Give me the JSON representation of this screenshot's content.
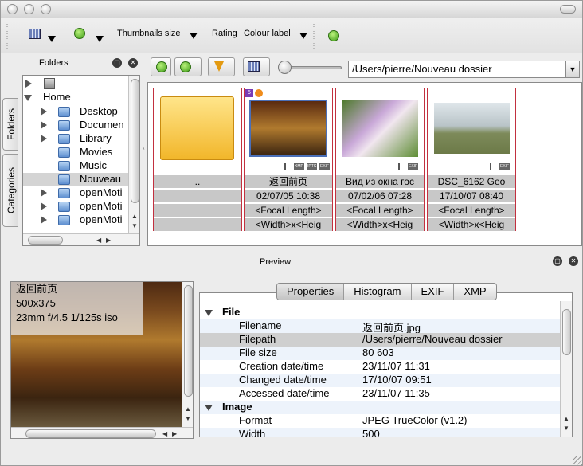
{
  "window": {
    "title": ""
  },
  "toolbar": {
    "thumbnails_size": "Thumbnails size",
    "rating": "Rating",
    "colour_label": "Colour label"
  },
  "folders_panel": {
    "title": "Folders",
    "tabs": [
      "Folders",
      "Categories"
    ],
    "tree": [
      {
        "label": "",
        "icon": "hard-drive-icon",
        "indent": 0,
        "expanded": false
      },
      {
        "label": "Home",
        "icon": "home-icon",
        "indent": 0,
        "expanded": true
      },
      {
        "label": "Desktop",
        "icon": "folder-icon",
        "indent": 1
      },
      {
        "label": "Documen",
        "icon": "folder-icon",
        "indent": 1
      },
      {
        "label": "Library",
        "icon": "folder-icon",
        "indent": 1
      },
      {
        "label": "Movies",
        "icon": "folder-icon",
        "indent": 1
      },
      {
        "label": "Music",
        "icon": "folder-icon",
        "indent": 1
      },
      {
        "label": "Nouveau",
        "icon": "folder-icon",
        "indent": 1,
        "selected": true
      },
      {
        "label": "openMoti",
        "icon": "folder-icon",
        "indent": 1
      },
      {
        "label": "openMoti",
        "icon": "folder-icon",
        "indent": 1
      },
      {
        "label": "openMoti",
        "icon": "folder-icon",
        "indent": 1
      }
    ]
  },
  "viewer": {
    "path": "/Users/pierre/Nouveau dossier",
    "thumbs": [
      {
        "name": "..",
        "type": "folder",
        "lines": [
          "..",
          "",
          "",
          ""
        ]
      },
      {
        "name": "返回前页",
        "type": "photo",
        "badge": "5",
        "lines": [
          "返回前页",
          "02/07/05 10:38",
          "<Focal Length>",
          "<Width>x<Heig"
        ]
      },
      {
        "name": "Вид из окна гос",
        "type": "photo",
        "lines": [
          "Вид из окна гос",
          "07/02/06 07:28",
          "<Focal Length>",
          "<Width>x<Heig"
        ]
      },
      {
        "name": "DSC_6162 Geo",
        "type": "photo",
        "lines": [
          "DSC_6162 Geo",
          "17/10/07 08:40",
          "<Focal Length>",
          "<Width>x<Heig"
        ]
      }
    ],
    "mini_badges": [
      "XMP",
      "IPTC",
      "EXIF"
    ]
  },
  "preview": {
    "label": "Preview",
    "overlay": [
      "返回前页",
      "500x375",
      "23mm f/4.5 1/125s iso"
    ]
  },
  "properties": {
    "tabs": [
      "Properties",
      "Histogram",
      "EXIF",
      "XMP"
    ],
    "selected_tab": "Properties",
    "groups": [
      {
        "title": "File",
        "rows": [
          [
            "Filename",
            "返回前页.jpg"
          ],
          [
            "Filepath",
            "/Users/pierre/Nouveau dossier"
          ],
          [
            "File size",
            "80 603"
          ],
          [
            "Creation date/time",
            "23/11/07 11:31"
          ],
          [
            "Changed date/time",
            "17/10/07 09:51"
          ],
          [
            "Accessed date/time",
            "23/11/07 11:35"
          ]
        ]
      },
      {
        "title": "Image",
        "rows": [
          [
            "Format",
            "JPEG TrueColor (v1.2)"
          ],
          [
            "Width",
            "500"
          ]
        ]
      }
    ]
  },
  "colors": {
    "selection_border": "#c2303f",
    "caption_bg": "#c8c8c8"
  }
}
